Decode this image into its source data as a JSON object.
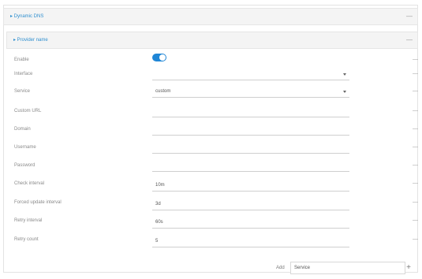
{
  "section1": {
    "title": "▸ Dynamic DNS",
    "menu_icon": "ellipsis-icon"
  },
  "section2": {
    "title": "▸ Provider name",
    "menu_icon": "ellipsis-icon"
  },
  "accent_color": "#1f86d6",
  "fields": [
    {
      "label": "Enable",
      "type": "toggle",
      "value": "on"
    },
    {
      "label": "Interface",
      "type": "select",
      "value": ""
    },
    {
      "label": "Service",
      "type": "select",
      "value": "custom"
    },
    {
      "label": "Custom URL",
      "type": "text",
      "value": ""
    },
    {
      "label": "Domain",
      "type": "text",
      "value": ""
    },
    {
      "label": "Username",
      "type": "text",
      "value": ""
    },
    {
      "label": "Password",
      "type": "text",
      "value": ""
    },
    {
      "label": "Check interval",
      "type": "text",
      "value": "10m"
    },
    {
      "label": "Forced update interval",
      "type": "text",
      "value": "3d"
    },
    {
      "label": "Retry interval",
      "type": "text",
      "value": "60s"
    },
    {
      "label": "Retry count",
      "type": "text",
      "value": "5"
    }
  ],
  "add": {
    "label": "Add",
    "service_value": "Service",
    "button": "+"
  }
}
